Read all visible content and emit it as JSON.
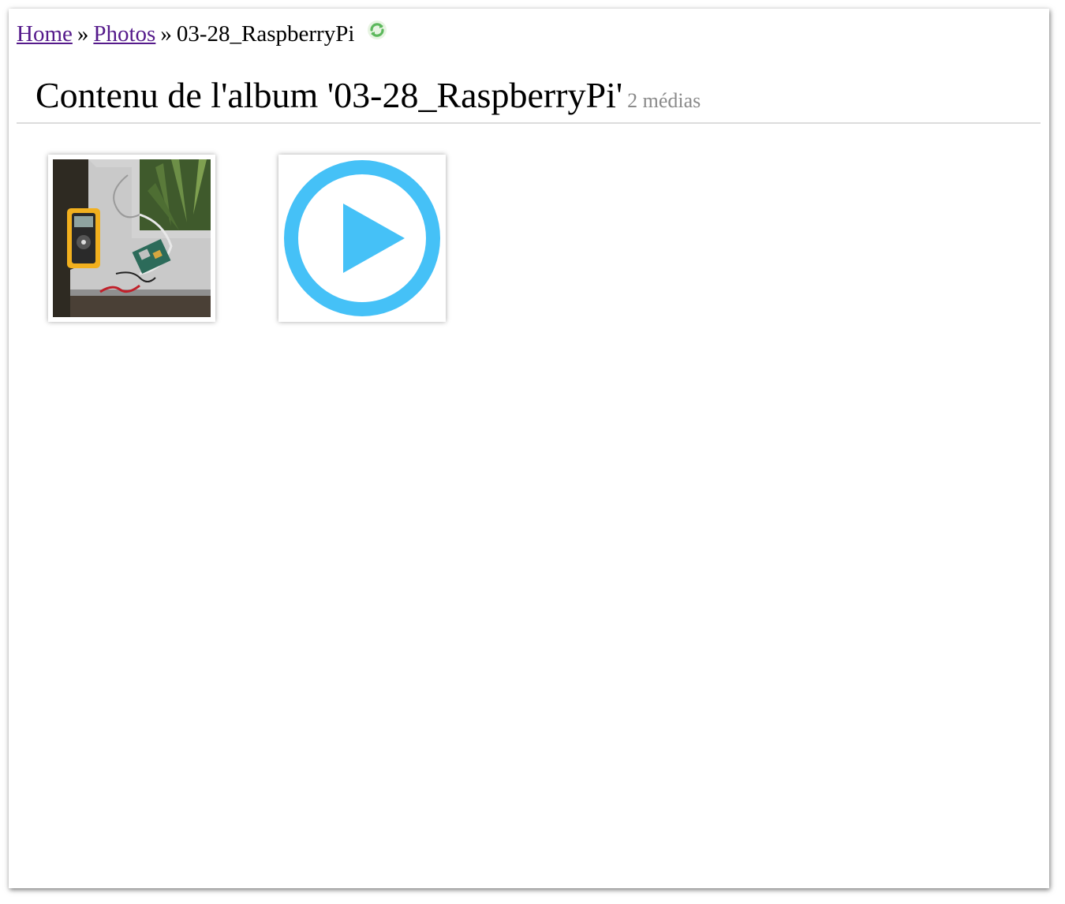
{
  "breadcrumb": {
    "home": "Home",
    "sep1": "»",
    "photos": "Photos",
    "sep2": "»",
    "current": "03-28_RaspberryPi"
  },
  "header": {
    "title": "Contenu de l'album '03-28_RaspberryPi'",
    "count": "2 médias"
  },
  "media": [
    {
      "type": "photo",
      "icon": "photo-thumbnail"
    },
    {
      "type": "video",
      "icon": "play-circle-icon"
    }
  ],
  "colors": {
    "link": "#551a8b",
    "play_icon": "#45c1f7",
    "refresh_icon": "#5cb85c",
    "muted": "#8a8a8a"
  }
}
